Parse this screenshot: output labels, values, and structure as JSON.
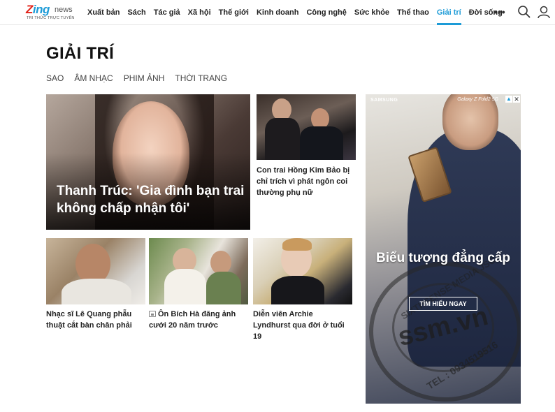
{
  "header": {
    "logo": {
      "brand_z": "Z",
      "brand_rest": "ing",
      "news": "news",
      "tagline": "TRI THỨC TRỰC TUYẾN"
    },
    "nav": [
      {
        "label": "Xuất bản"
      },
      {
        "label": "Sách"
      },
      {
        "label": "Tác giả"
      },
      {
        "label": "Xã hội"
      },
      {
        "label": "Thế giới"
      },
      {
        "label": "Kinh doanh"
      },
      {
        "label": "Công nghệ"
      },
      {
        "label": "Sức khỏe"
      },
      {
        "label": "Thể thao"
      },
      {
        "label": "Giải trí",
        "active": true
      },
      {
        "label": "Đời sống"
      }
    ],
    "more": "•••",
    "icons": [
      "search-icon",
      "user-icon"
    ]
  },
  "section": {
    "title": "GIẢI TRÍ",
    "subnav": [
      "SAO",
      "ÂM NHẠC",
      "PHIM ẢNH",
      "THỜI TRANG"
    ]
  },
  "articles": {
    "feature": {
      "headline": "Thanh Trúc: 'Gia đình bạn trai không chấp nhận tôi'"
    },
    "side": {
      "headline": "Con trai Hồng Kim Bảo bị chỉ trích vì phát ngôn coi thường phụ nữ"
    },
    "row": [
      {
        "headline": "Nhạc sĩ Lê Quang phẫu thuật cắt bàn chân phải"
      },
      {
        "headline": "Ôn Bích Hà đăng ảnh cưới 20 năm trước",
        "has_photo_icon": true
      },
      {
        "headline": "Diễn viên Archie Lyndhurst qua đời ở tuổi 19"
      }
    ]
  },
  "ad": {
    "brand": "SAMSUNG",
    "product": "Galaxy Z Fold2 5G",
    "title": "Biểu tượng đẳng cấp",
    "cta": "TÌM HIỂU NGAY",
    "watermark": {
      "main": "ssm.vn",
      "arc": "SIXTHSENSE MEDIA JSC",
      "tel": "TEL : 0934519516"
    }
  },
  "colors": {
    "accent": "#1d9bd7",
    "logo_red": "#e2231a",
    "text": "#222222"
  }
}
